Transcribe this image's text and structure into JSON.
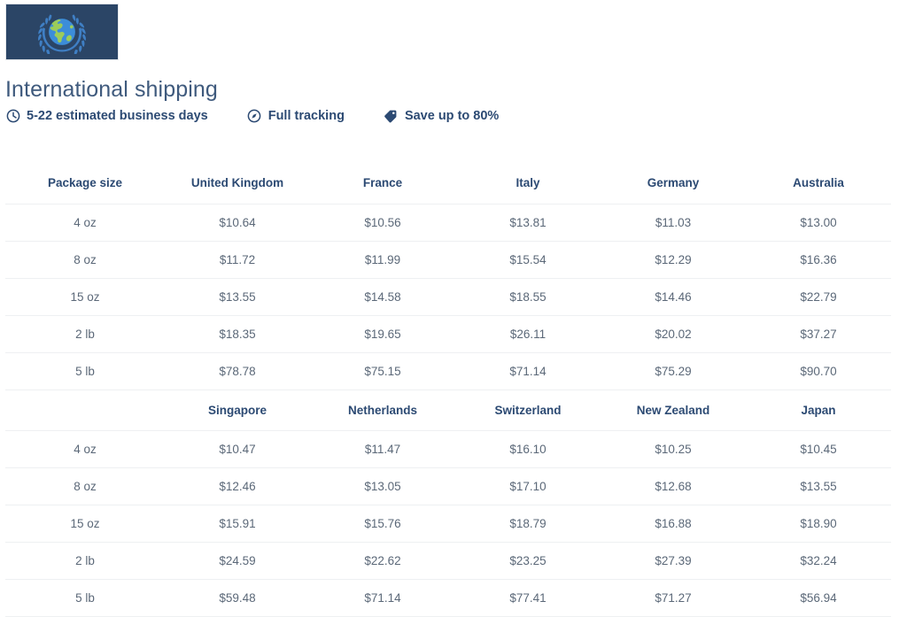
{
  "brand": {
    "logo_icon": "globe-laurel-wreath-logo",
    "logo_bg": "#2b4566",
    "globe_land_color": "#9ccc5a",
    "globe_water_color": "#3c8dd9",
    "wreath_color": "#3f7fc4"
  },
  "header": {
    "title": "International shipping",
    "title_color": "#3f5a7d",
    "badges": [
      {
        "icon": "clock-icon",
        "label": "5-22 estimated business days"
      },
      {
        "icon": "compass-icon",
        "label": "Full tracking"
      },
      {
        "icon": "price-tag-icon",
        "label": "Save up to 80%"
      }
    ]
  },
  "theme": {
    "header_text_color": "#2c4a73",
    "cell_text_color": "#5b6878",
    "row_divider_color": "#eef0f2"
  },
  "chart_data": {
    "type": "table",
    "title": "International shipping",
    "tables": [
      {
        "columns": [
          "Package size",
          "United Kingdom",
          "France",
          "Italy",
          "Germany",
          "Australia"
        ],
        "rows": [
          [
            "4 oz",
            "$10.64",
            "$10.56",
            "$13.81",
            "$11.03",
            "$13.00"
          ],
          [
            "8 oz",
            "$11.72",
            "$11.99",
            "$15.54",
            "$12.29",
            "$16.36"
          ],
          [
            "15 oz",
            "$13.55",
            "$14.58",
            "$18.55",
            "$14.46",
            "$22.79"
          ],
          [
            "2 lb",
            "$18.35",
            "$19.65",
            "$26.11",
            "$20.02",
            "$37.27"
          ],
          [
            "5 lb",
            "$78.78",
            "$75.15",
            "$71.14",
            "$75.29",
            "$90.70"
          ]
        ]
      },
      {
        "columns": [
          "",
          "Singapore",
          "Netherlands",
          "Switzerland",
          "New Zealand",
          "Japan"
        ],
        "rows": [
          [
            "4 oz",
            "$10.47",
            "$11.47",
            "$16.10",
            "$10.25",
            "$10.45"
          ],
          [
            "8 oz",
            "$12.46",
            "$13.05",
            "$17.10",
            "$12.68",
            "$13.55"
          ],
          [
            "15 oz",
            "$15.91",
            "$15.76",
            "$18.79",
            "$16.88",
            "$18.90"
          ],
          [
            "2 lb",
            "$24.59",
            "$22.62",
            "$23.25",
            "$27.39",
            "$32.24"
          ],
          [
            "5 lb",
            "$59.48",
            "$71.14",
            "$77.41",
            "$71.27",
            "$56.94"
          ]
        ]
      }
    ]
  }
}
